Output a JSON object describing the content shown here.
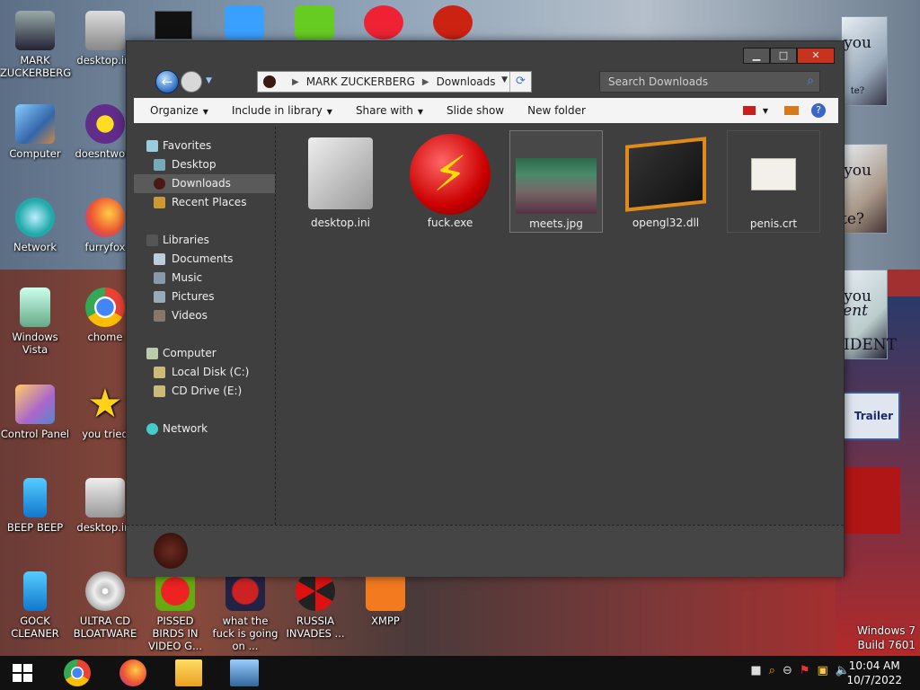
{
  "desktop": {
    "icons": [
      {
        "label": "MARK ZUCKERBERG",
        "icon": "user-folder-icon"
      },
      {
        "label": "desktop.ini",
        "icon": "config-file-icon"
      },
      {
        "label": "Computer",
        "icon": "computer-icon"
      },
      {
        "label": "doesntwork",
        "icon": "yahoo-icon"
      },
      {
        "label": "Network",
        "icon": "network-icon"
      },
      {
        "label": "furryfox",
        "icon": "firefox-icon"
      },
      {
        "label": "Windows Vista",
        "icon": "recycle-bin-icon"
      },
      {
        "label": "chome",
        "icon": "chrome-icon"
      },
      {
        "label": "Control Panel",
        "icon": "control-panel-icon"
      },
      {
        "label": "you tried",
        "icon": "star-icon"
      },
      {
        "label": "BEEP BEEP",
        "icon": "blue-app-icon"
      },
      {
        "label": "desktop.ini",
        "icon": "config-file-icon"
      },
      {
        "label": "GOCK CLEANER",
        "icon": "cleaner-icon"
      },
      {
        "label": "ULTRA CD BLOATWARE",
        "icon": "cd-icon"
      },
      {
        "label": "PISSED BIRDS IN VIDEO G...",
        "icon": "angry-bird-icon"
      },
      {
        "label": "what the fuck is going on ...",
        "icon": "angry-bird-space-icon"
      },
      {
        "label": "RUSSIA INVADES ...",
        "icon": "radiation-icon"
      },
      {
        "label": "XMPP",
        "icon": "xampp-icon"
      }
    ],
    "watermark": {
      "line1": "Windows 7",
      "line2": "Build 7601"
    },
    "ad_texts": [
      "you",
      "you",
      "te?",
      "you",
      "ent",
      "te?",
      "RESIDENT",
      "Trailer"
    ]
  },
  "window": {
    "address": {
      "segments": [
        "MARK ZUCKERBERG",
        "Downloads"
      ]
    },
    "search_placeholder": "Search Downloads",
    "caption": {
      "minimize": "▁",
      "maximize": "□",
      "close": "✕"
    },
    "commands": [
      "Organize",
      "Include in library",
      "Share with",
      "Slide show",
      "New folder"
    ],
    "nav": {
      "favorites": {
        "label": "Favorites",
        "items": [
          "Desktop",
          "Downloads",
          "Recent Places"
        ]
      },
      "libraries": {
        "label": "Libraries",
        "items": [
          "Documents",
          "Music",
          "Pictures",
          "Videos"
        ]
      },
      "computer": {
        "label": "Computer",
        "items": [
          "Local Disk (C:)",
          "CD Drive (E:)"
        ]
      },
      "network": {
        "label": "Network"
      }
    },
    "selected_nav": "Downloads",
    "files": [
      {
        "name": "desktop.ini",
        "icon": "settings-file-icon"
      },
      {
        "name": "fuck.exe",
        "icon": "lightning-icon"
      },
      {
        "name": "meets.jpg",
        "icon": "photo-thumbnail-icon"
      },
      {
        "name": "opengl32.dll",
        "icon": "dll-file-icon"
      },
      {
        "name": "penis.crt",
        "icon": "certificate-icon"
      }
    ]
  },
  "taskbar": {
    "apps": [
      "chrome-icon",
      "firefox-icon",
      "file-explorer-icon",
      "task-manager-icon"
    ],
    "clock": {
      "time": "10:04 AM",
      "date": "10/7/2022"
    },
    "tray_icons": [
      "action-center-icon",
      "search-icon",
      "minus-icon",
      "flag-icon",
      "network-icon",
      "volume-icon"
    ]
  },
  "colors": {
    "window_bg": "#3f3f3f",
    "close_button": "#c8331f",
    "selection": "#5a5a5a"
  }
}
